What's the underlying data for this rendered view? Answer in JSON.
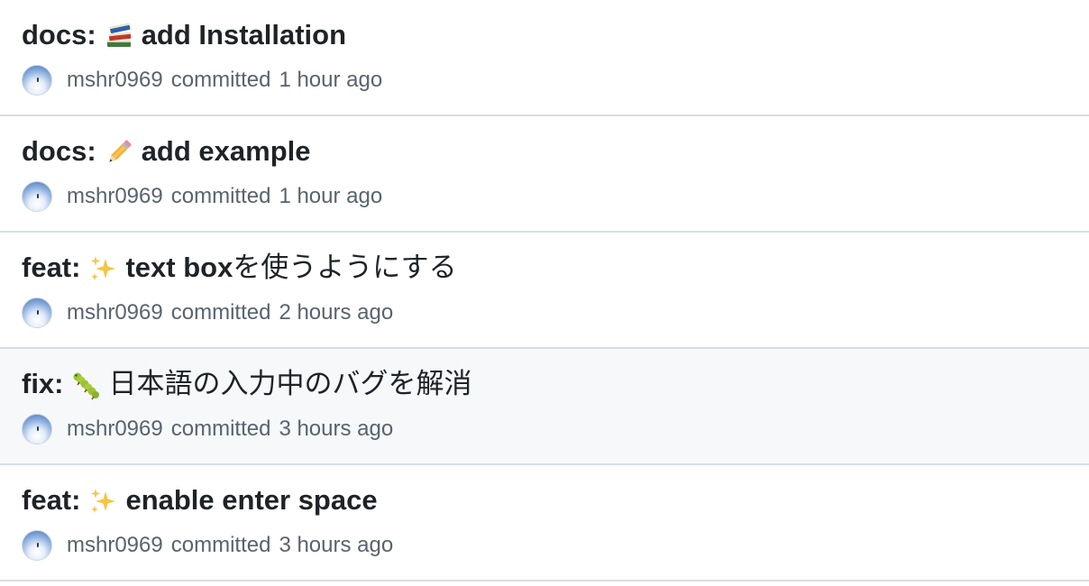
{
  "commits": [
    {
      "prefix": "docs:",
      "emoji": "books",
      "message": "add Installation",
      "author": "mshr0969",
      "verb": "committed",
      "time": "1 hour ago"
    },
    {
      "prefix": "docs:",
      "emoji": "pencil",
      "message": "add example",
      "author": "mshr0969",
      "verb": "committed",
      "time": "1 hour ago"
    },
    {
      "prefix": "feat:",
      "emoji": "sparkles",
      "message_latin": "text box",
      "message_jp": "を使うようにする",
      "author": "mshr0969",
      "verb": "committed",
      "time": "2 hours ago"
    },
    {
      "prefix": "fix:",
      "emoji": "bug",
      "message_jp": "日本語の入力中のバグを解消",
      "author": "mshr0969",
      "verb": "committed",
      "time": "3 hours ago"
    },
    {
      "prefix": "feat:",
      "emoji": "sparkles",
      "message": "enable enter space",
      "author": "mshr0969",
      "verb": "committed",
      "time": "3 hours ago"
    }
  ],
  "colors": {
    "row_hover_background": "#f6f8fa",
    "divider": "#d8dee4",
    "title_text": "#1f2328",
    "meta_text": "#59636e"
  }
}
